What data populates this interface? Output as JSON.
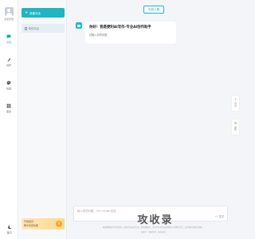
{
  "rail": {
    "login_label": "点击登录",
    "items": [
      {
        "label": "对话",
        "icon": "chat-icon"
      },
      {
        "label": "创作",
        "icon": "feather-icon"
      },
      {
        "label": "绘画",
        "icon": "palette-icon"
      },
      {
        "label": "更多",
        "icon": "apps-icon"
      }
    ],
    "bottom_icon": "moon-icon",
    "bottom_label": "夜间"
  },
  "conversations": {
    "new_label": "新建对话",
    "items": [
      {
        "label": "新的对话"
      }
    ],
    "promo_line1": "开通会员",
    "promo_line2": "畅享高级功能",
    "promo_badge": "V"
  },
  "main": {
    "top_pill": "在线人数",
    "greeting_title": "你好！我是便利AI写作-专业AI创作助手",
    "greeting_sub": "请输入你的问题",
    "tools": [
      {
        "glyph": "⇪",
        "label": "分享"
      },
      {
        "glyph": "⚙",
        "label": "反馈"
      }
    ],
    "input_placeholder": "输入您的问题，Ctrl+Enter发送",
    "send_label": "发送",
    "footer_note_1": "最终解释权归本站所有，服务内容由AI生成，请谨慎甄别，本站不对内容的准确性与完整性负责，如有疑问请联系客服。",
    "footer_note_2": "备案号 · 版权所有 · 技术支持",
    "watermark": "攻收录"
  },
  "colors": {
    "accent": "#1fb5c3",
    "promo": "#fbd98c"
  }
}
